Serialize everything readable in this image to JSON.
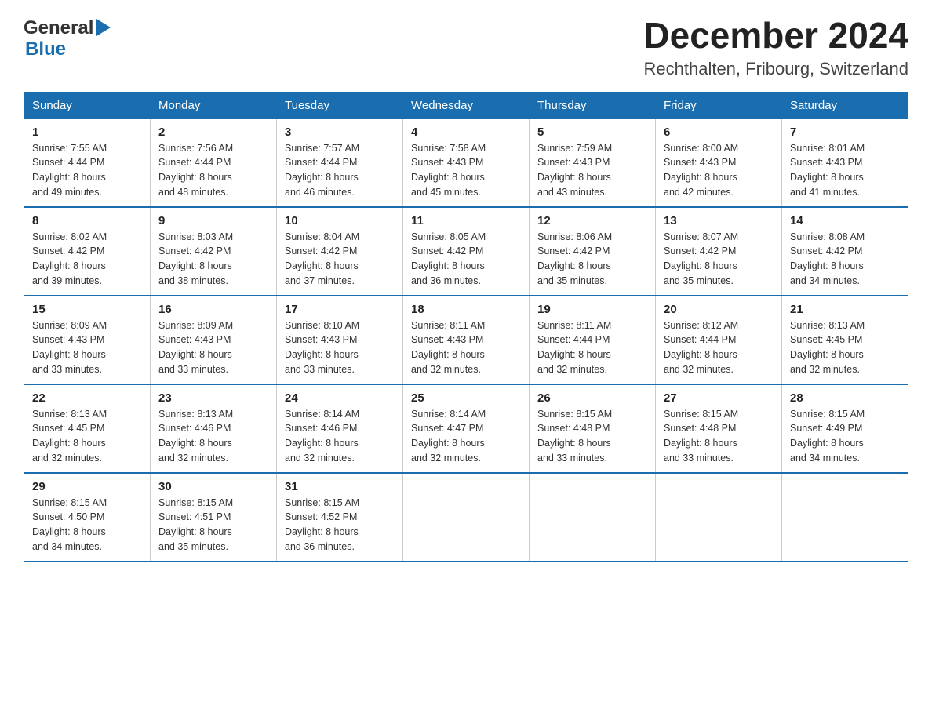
{
  "header": {
    "logo_general": "General",
    "logo_blue": "Blue",
    "month_title": "December 2024",
    "location": "Rechthalten, Fribourg, Switzerland"
  },
  "days_of_week": [
    "Sunday",
    "Monday",
    "Tuesday",
    "Wednesday",
    "Thursday",
    "Friday",
    "Saturday"
  ],
  "weeks": [
    [
      {
        "day": "1",
        "sunrise": "7:55 AM",
        "sunset": "4:44 PM",
        "daylight": "8 hours and 49 minutes."
      },
      {
        "day": "2",
        "sunrise": "7:56 AM",
        "sunset": "4:44 PM",
        "daylight": "8 hours and 48 minutes."
      },
      {
        "day": "3",
        "sunrise": "7:57 AM",
        "sunset": "4:44 PM",
        "daylight": "8 hours and 46 minutes."
      },
      {
        "day": "4",
        "sunrise": "7:58 AM",
        "sunset": "4:43 PM",
        "daylight": "8 hours and 45 minutes."
      },
      {
        "day": "5",
        "sunrise": "7:59 AM",
        "sunset": "4:43 PM",
        "daylight": "8 hours and 43 minutes."
      },
      {
        "day": "6",
        "sunrise": "8:00 AM",
        "sunset": "4:43 PM",
        "daylight": "8 hours and 42 minutes."
      },
      {
        "day": "7",
        "sunrise": "8:01 AM",
        "sunset": "4:43 PM",
        "daylight": "8 hours and 41 minutes."
      }
    ],
    [
      {
        "day": "8",
        "sunrise": "8:02 AM",
        "sunset": "4:42 PM",
        "daylight": "8 hours and 39 minutes."
      },
      {
        "day": "9",
        "sunrise": "8:03 AM",
        "sunset": "4:42 PM",
        "daylight": "8 hours and 38 minutes."
      },
      {
        "day": "10",
        "sunrise": "8:04 AM",
        "sunset": "4:42 PM",
        "daylight": "8 hours and 37 minutes."
      },
      {
        "day": "11",
        "sunrise": "8:05 AM",
        "sunset": "4:42 PM",
        "daylight": "8 hours and 36 minutes."
      },
      {
        "day": "12",
        "sunrise": "8:06 AM",
        "sunset": "4:42 PM",
        "daylight": "8 hours and 35 minutes."
      },
      {
        "day": "13",
        "sunrise": "8:07 AM",
        "sunset": "4:42 PM",
        "daylight": "8 hours and 35 minutes."
      },
      {
        "day": "14",
        "sunrise": "8:08 AM",
        "sunset": "4:42 PM",
        "daylight": "8 hours and 34 minutes."
      }
    ],
    [
      {
        "day": "15",
        "sunrise": "8:09 AM",
        "sunset": "4:43 PM",
        "daylight": "8 hours and 33 minutes."
      },
      {
        "day": "16",
        "sunrise": "8:09 AM",
        "sunset": "4:43 PM",
        "daylight": "8 hours and 33 minutes."
      },
      {
        "day": "17",
        "sunrise": "8:10 AM",
        "sunset": "4:43 PM",
        "daylight": "8 hours and 33 minutes."
      },
      {
        "day": "18",
        "sunrise": "8:11 AM",
        "sunset": "4:43 PM",
        "daylight": "8 hours and 32 minutes."
      },
      {
        "day": "19",
        "sunrise": "8:11 AM",
        "sunset": "4:44 PM",
        "daylight": "8 hours and 32 minutes."
      },
      {
        "day": "20",
        "sunrise": "8:12 AM",
        "sunset": "4:44 PM",
        "daylight": "8 hours and 32 minutes."
      },
      {
        "day": "21",
        "sunrise": "8:13 AM",
        "sunset": "4:45 PM",
        "daylight": "8 hours and 32 minutes."
      }
    ],
    [
      {
        "day": "22",
        "sunrise": "8:13 AM",
        "sunset": "4:45 PM",
        "daylight": "8 hours and 32 minutes."
      },
      {
        "day": "23",
        "sunrise": "8:13 AM",
        "sunset": "4:46 PM",
        "daylight": "8 hours and 32 minutes."
      },
      {
        "day": "24",
        "sunrise": "8:14 AM",
        "sunset": "4:46 PM",
        "daylight": "8 hours and 32 minutes."
      },
      {
        "day": "25",
        "sunrise": "8:14 AM",
        "sunset": "4:47 PM",
        "daylight": "8 hours and 32 minutes."
      },
      {
        "day": "26",
        "sunrise": "8:15 AM",
        "sunset": "4:48 PM",
        "daylight": "8 hours and 33 minutes."
      },
      {
        "day": "27",
        "sunrise": "8:15 AM",
        "sunset": "4:48 PM",
        "daylight": "8 hours and 33 minutes."
      },
      {
        "day": "28",
        "sunrise": "8:15 AM",
        "sunset": "4:49 PM",
        "daylight": "8 hours and 34 minutes."
      }
    ],
    [
      {
        "day": "29",
        "sunrise": "8:15 AM",
        "sunset": "4:50 PM",
        "daylight": "8 hours and 34 minutes."
      },
      {
        "day": "30",
        "sunrise": "8:15 AM",
        "sunset": "4:51 PM",
        "daylight": "8 hours and 35 minutes."
      },
      {
        "day": "31",
        "sunrise": "8:15 AM",
        "sunset": "4:52 PM",
        "daylight": "8 hours and 36 minutes."
      },
      null,
      null,
      null,
      null
    ]
  ],
  "labels": {
    "sunrise": "Sunrise:",
    "sunset": "Sunset:",
    "daylight": "Daylight:"
  }
}
